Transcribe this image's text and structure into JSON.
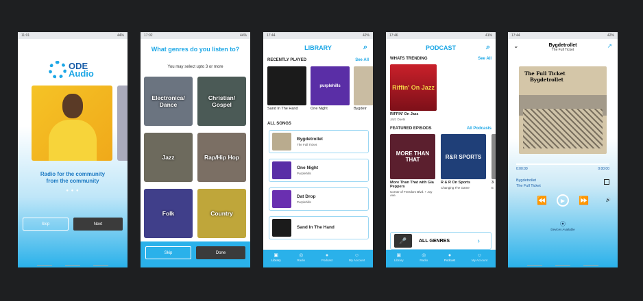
{
  "colors": {
    "accent": "#1da7e6",
    "nav": "#2ab1ea",
    "dark_btn": "#3b3b3b"
  },
  "p1": {
    "status_time": "11:01",
    "status_right": "44%",
    "logo_line1": "ODE",
    "logo_line2": "Audio",
    "tagline_1": "Radio for the community",
    "tagline_2": "from the community",
    "dots": "● ● ●",
    "skip": "Skip",
    "next": "Next"
  },
  "p2": {
    "status_time": "17:02",
    "status_right": "44%",
    "title": "What genres do you listen to?",
    "subtitle": "You may select upto 3 or more",
    "genres": [
      {
        "line1": "Electronica/",
        "line2": "Dance",
        "color": "#6b7480"
      },
      {
        "line1": "Christian/",
        "line2": "Gospel",
        "color": "#4b5a56"
      },
      {
        "line1": "Jazz",
        "line2": "",
        "color": "#6d6a5d"
      },
      {
        "line1": "Rap/Hip Hop",
        "line2": "",
        "color": "#7b6f64"
      },
      {
        "line1": "Folk",
        "line2": "",
        "color": "#403f8a"
      },
      {
        "line1": "Country",
        "line2": "",
        "color": "#bfa63a"
      }
    ],
    "skip": "Skip",
    "done": "Done"
  },
  "p3": {
    "status_time": "17:44",
    "status_right": "42%",
    "title": "LIBRARY",
    "search_icon": "search-icon",
    "recent_label": "RECENTLY PLAYED",
    "see_all": "See All",
    "recent": [
      {
        "title": "Sand In The Hand",
        "color": "#1b1b1b",
        "text": ""
      },
      {
        "title": "One Night",
        "color": "#5a2ea6",
        "text": "purplehills"
      },
      {
        "title": "Bygdetr",
        "color": "#c9bca2",
        "text": ""
      }
    ],
    "songs_label": "ALL SONGS",
    "songs": [
      {
        "title": "Bygdetrollet",
        "artist": "The Full Ticket",
        "color": "#b9ab8e"
      },
      {
        "title": "One Night",
        "artist": "Purplehills",
        "color": "#5a2ea6"
      },
      {
        "title": "Dat Drop",
        "artist": "Purplehills",
        "color": "#6a2fb0"
      },
      {
        "title": "Sand In The Hand",
        "artist": "",
        "color": "#1b1b1b"
      }
    ],
    "tabs": [
      "Library",
      "Radio",
      "Podcast",
      "My Account"
    ]
  },
  "p4": {
    "status_time": "17:46",
    "status_right": "41%",
    "title": "PODCAST",
    "trending_label": "WHATS TRENDING",
    "see_all": "See All",
    "trending_title": "RIFFIN' On Jazz",
    "trending_sub": "Jazz Duets",
    "trending_art": "Riffin' On Jazz",
    "featured_label": "FEATURED EPISODS",
    "all_podcasts": "All Podcasts",
    "featured": [
      {
        "title": "More Than That with Gia Peppers",
        "sub": "Corner of Freedom Blvd. + Joy Ave.",
        "art": "MORE THAN THAT",
        "color": "#5b1f2e"
      },
      {
        "title": "R & R On Sports",
        "sub": "Changing The Game",
        "art": "R&R SPORTS",
        "color": "#1f3f78"
      },
      {
        "title": "3",
        "sub": "E",
        "art": "",
        "color": "#888"
      }
    ],
    "all_genres": "ALL GENRES",
    "tabs": [
      "Library",
      "Radio",
      "Podcast",
      "My Account"
    ]
  },
  "p5": {
    "status_time": "17:44",
    "status_right": "42%",
    "title": "Bygdetrollet",
    "subtitle": "The Full Ticket",
    "art_line1": "The Full Ticket",
    "art_line2": "Bygdetrollet",
    "time_start": "0:00:00",
    "time_end": "0:00:00",
    "track": "Bygdetrollet",
    "artist": "The Full Ticket",
    "devices": "Devices Available"
  }
}
